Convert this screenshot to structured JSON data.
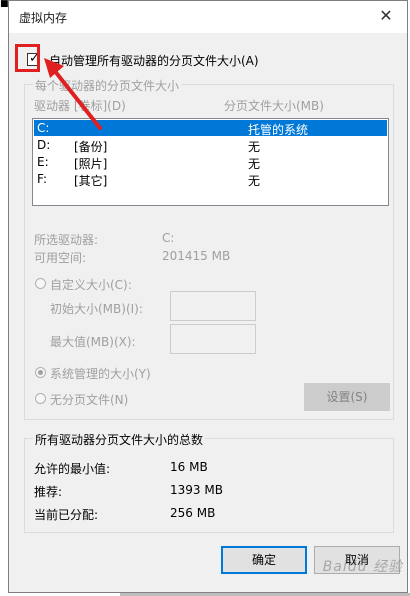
{
  "window": {
    "title": "虚拟内存",
    "close_glyph": "✕"
  },
  "auto_manage": {
    "label": "自动管理所有驱动器的分页文件大小(A)",
    "checked": true
  },
  "per_drive": {
    "group_title": "每个驱动器的分页文件大小",
    "col_drive": "驱动器 [卷标](D)",
    "col_size": "分页文件大小(MB)",
    "rows": [
      {
        "drive": "C:",
        "label": "",
        "size": "托管的系统",
        "selected": true
      },
      {
        "drive": "D:",
        "label": "[备份]",
        "size": "无",
        "selected": false
      },
      {
        "drive": "E:",
        "label": "[照片]",
        "size": "无",
        "selected": false
      },
      {
        "drive": "F:",
        "label": "[其它]",
        "size": "无",
        "selected": false
      }
    ],
    "selected_drive_label": "所选驱动器:",
    "selected_drive_value": "C:",
    "free_space_label": "可用空间:",
    "free_space_value": "201415 MB",
    "custom_size_label": "自定义大小(C):",
    "initial_size_label": "初始大小(MB)(I):",
    "max_size_label": "最大值(MB)(X):",
    "system_managed_label": "系统管理的大小(Y)",
    "no_paging_label": "无分页文件(N)",
    "set_button": "设置(S)"
  },
  "totals": {
    "group_title": "所有驱动器分页文件大小的总数",
    "min_label": "允许的最小值:",
    "min_value": "16 MB",
    "recommended_label": "推荐:",
    "recommended_value": "1393 MB",
    "current_label": "当前已分配:",
    "current_value": "256 MB"
  },
  "buttons": {
    "ok": "确定",
    "cancel": "取消"
  },
  "watermark": "Baidu 经验",
  "accent_color": "#0078d7",
  "highlight_color": "#e02020"
}
